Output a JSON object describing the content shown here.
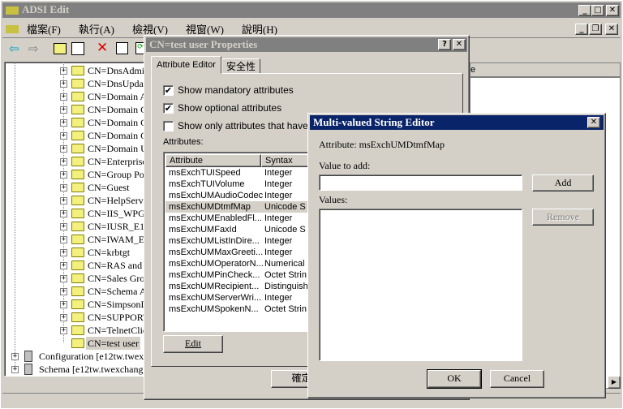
{
  "app": {
    "title": "ADSI Edit",
    "menu": [
      "檔案(F)",
      "執行(A)",
      "檢視(V)",
      "視窗(W)",
      "說明(H)"
    ]
  },
  "toolbar": {
    "icons": [
      "back-icon",
      "forward-icon",
      "up-folder-icon",
      "show-hide-tree-icon",
      "delete-icon",
      "properties-icon",
      "refresh-icon"
    ]
  },
  "tree": {
    "items": [
      "CN=DnsAdmin",
      "CN=DnsUpdate",
      "CN=Domain A",
      "CN=Domain C",
      "CN=Domain C",
      "CN=Domain G",
      "CN=Domain U",
      "CN=Enterprise",
      "CN=Group Pol",
      "CN=Guest",
      "CN=HelpServic",
      "CN=IIS_WPG",
      "CN=IUSR_E12",
      "CN=IWAM_E1",
      "CN=krbtgt",
      "CN=RAS and I",
      "CN=Sales Grou",
      "CN=Schema Ad",
      "CN=SimpsonD",
      "CN=SUPPORT",
      "CN=TelnetClie"
    ],
    "selected": "CN=test user",
    "roots": [
      "Configuration [e12tw.twexc",
      "Schema [e12tw.twexchange"
    ]
  },
  "right_pane": {
    "header_fragment": "e"
  },
  "properties": {
    "title": "CN=test user Properties",
    "tabs": [
      "Attribute Editor",
      "安全性"
    ],
    "checkboxes": [
      {
        "label": "Show mandatory attributes",
        "checked": true
      },
      {
        "label": "Show optional attributes",
        "checked": true
      },
      {
        "label": "Show only attributes that have val",
        "checked": false
      }
    ],
    "attributes_label": "Attributes:",
    "columns": [
      "Attribute",
      "Syntax"
    ],
    "rows": [
      [
        "msExchTUISpeed",
        "Integer"
      ],
      [
        "msExchTUIVolume",
        "Integer"
      ],
      [
        "msExchUMAudioCodec",
        "Integer"
      ],
      [
        "msExchUMDtmfMap",
        "Unicode S"
      ],
      [
        "msExchUMEnabledFl...",
        "Integer"
      ],
      [
        "msExchUMFaxId",
        "Unicode S"
      ],
      [
        "msExchUMListInDire...",
        "Integer"
      ],
      [
        "msExchUMMaxGreeti...",
        "Integer"
      ],
      [
        "msExchUMOperatorN...",
        "Numerical"
      ],
      [
        "msExchUMPinCheck...",
        "Octet Strin"
      ],
      [
        "msExchUMRecipient...",
        "Distinguish"
      ],
      [
        "msExchUMServerWri...",
        "Integer"
      ],
      [
        "msExchUMSpokenN...",
        "Octet Strin"
      ]
    ],
    "selected_row": 3,
    "edit_label": "Edit",
    "ok_label": "確定"
  },
  "mvse": {
    "title": "Multi-valued String Editor",
    "attribute_text": "Attribute: msExchUMDtmfMap",
    "value_label": "Value to add:",
    "value": "",
    "values_label": "Values:",
    "add_label": "Add",
    "remove_label": "Remove",
    "ok_label": "OK",
    "cancel_label": "Cancel"
  },
  "colors": {
    "active_title": "#0a246a",
    "inactive_title": "#808080",
    "face": "#d4d0c8"
  }
}
